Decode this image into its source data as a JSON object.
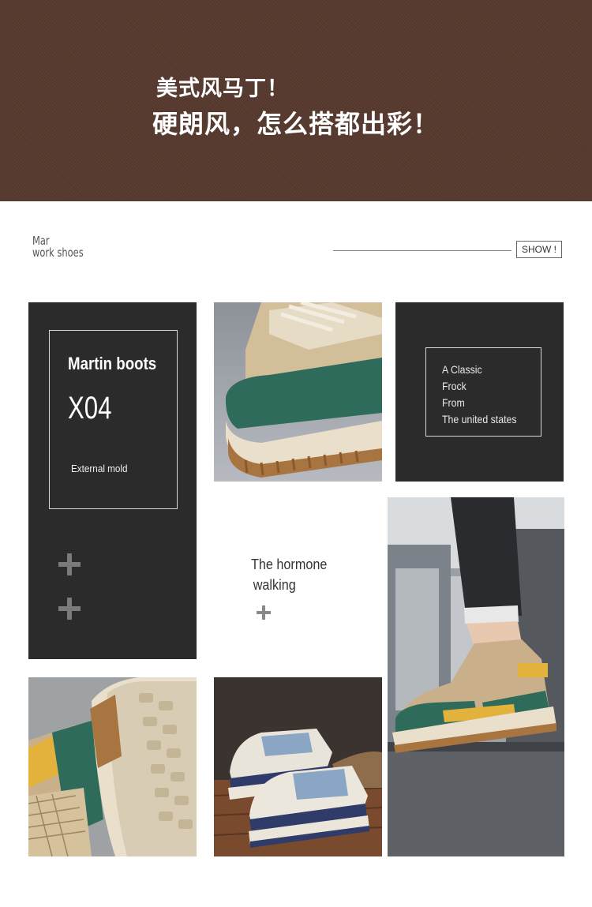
{
  "banner": {
    "line1": "美式风马丁！",
    "line2": "硬朗风，怎么搭都出彩！",
    "color": "#5b3d32"
  },
  "section": {
    "brand_line1": "Mar",
    "brand_line2": "work shoes",
    "show_label": "SHOW !"
  },
  "panel_left": {
    "title": "Martin boots",
    "model": "X04",
    "subtitle": "External mold"
  },
  "panel_right": {
    "lines": [
      "A Classic",
      "Frock",
      "From",
      "The united states"
    ]
  },
  "middle_text": {
    "line1": "The hormone",
    "line2": "walking"
  },
  "photos": {
    "closeup_toe": "shoe-toe-closeup-photo",
    "street_model": "street-model-shoe-photo",
    "sole_detail": "sole-detail-photo",
    "pair_on_wood": "shoe-pair-wood-floor-photo"
  },
  "colors": {
    "panel_dark": "#2b2b2b",
    "suede_beige": "#c9b08a",
    "suede_green": "#2f6b5a",
    "sole_brown": "#a8743f",
    "accent_yellow": "#e3b23c"
  }
}
